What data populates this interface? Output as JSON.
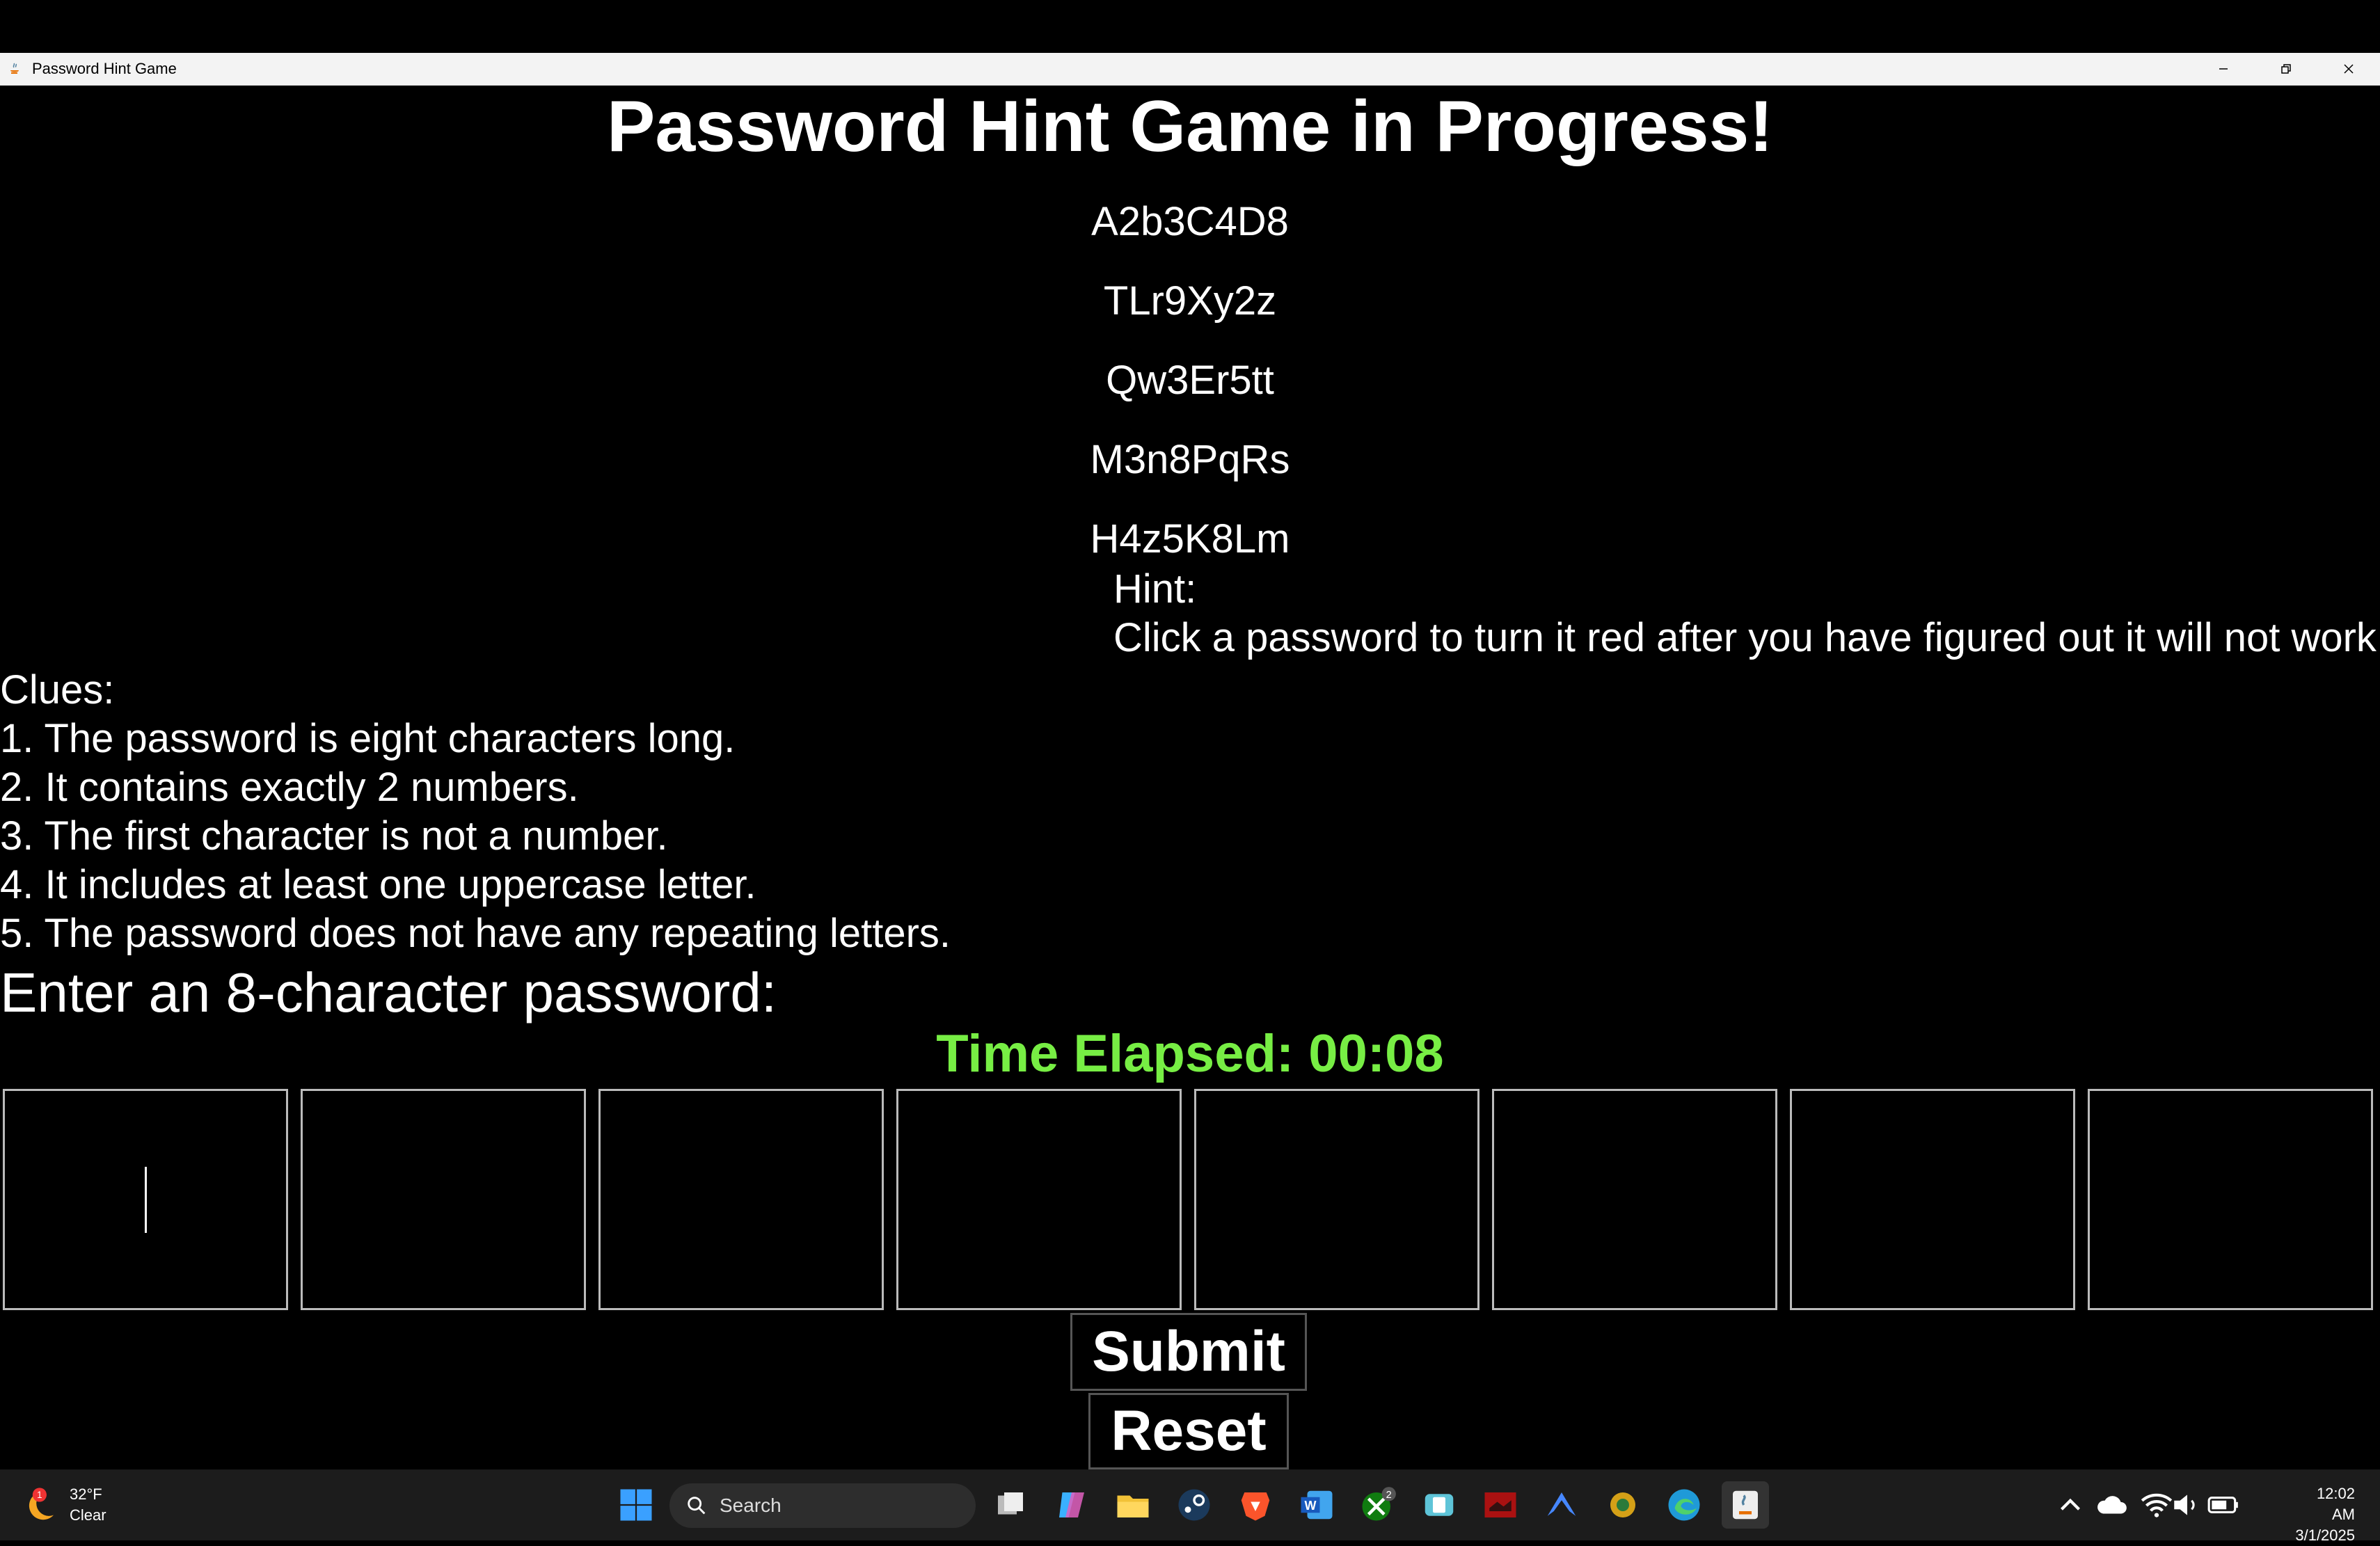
{
  "window": {
    "title": "Password Hint Game"
  },
  "game": {
    "title": "Password Hint Game in Progress!",
    "passwords": [
      "A2b3C4D8",
      "TLr9Xy2z",
      "Qw3Er5tt",
      "M3n8PqRs",
      "H4z5K8Lm"
    ],
    "hint_label": "Hint:",
    "hint_text": "Click a password to turn it red after you have figured out it will not work!",
    "clues_label": "Clues:",
    "clues": [
      "1. The password is eight characters long.",
      "2. It contains exactly 2 numbers.",
      "3. The first character is not a number.",
      "4. It includes at least one uppercase letter.",
      "5. The password does not have any repeating letters."
    ],
    "prompt": "Enter an 8-character password:",
    "timer": "Time Elapsed: 00:08",
    "timer_color": "#77ee44",
    "input_boxes": [
      "",
      "",
      "",
      "",
      "",
      "",
      "",
      ""
    ],
    "submit_label": "Submit",
    "reset_label": "Reset"
  },
  "taskbar": {
    "weather_temp": "32°F",
    "weather_desc": "Clear",
    "weather_badge": "1",
    "search_placeholder": "Search",
    "xbox_badge": "2",
    "time": "12:02 AM",
    "date": "3/1/2025",
    "apps": [
      "start-icon",
      "task-view-icon",
      "copilot-icon",
      "file-explorer-icon",
      "steam-icon",
      "brave-icon",
      "word-icon",
      "xbox-icon",
      "phone-link-icon",
      "game-app-icon",
      "nordvpn-icon",
      "snipping-icon",
      "edge-icon",
      "java-app-icon"
    ]
  }
}
